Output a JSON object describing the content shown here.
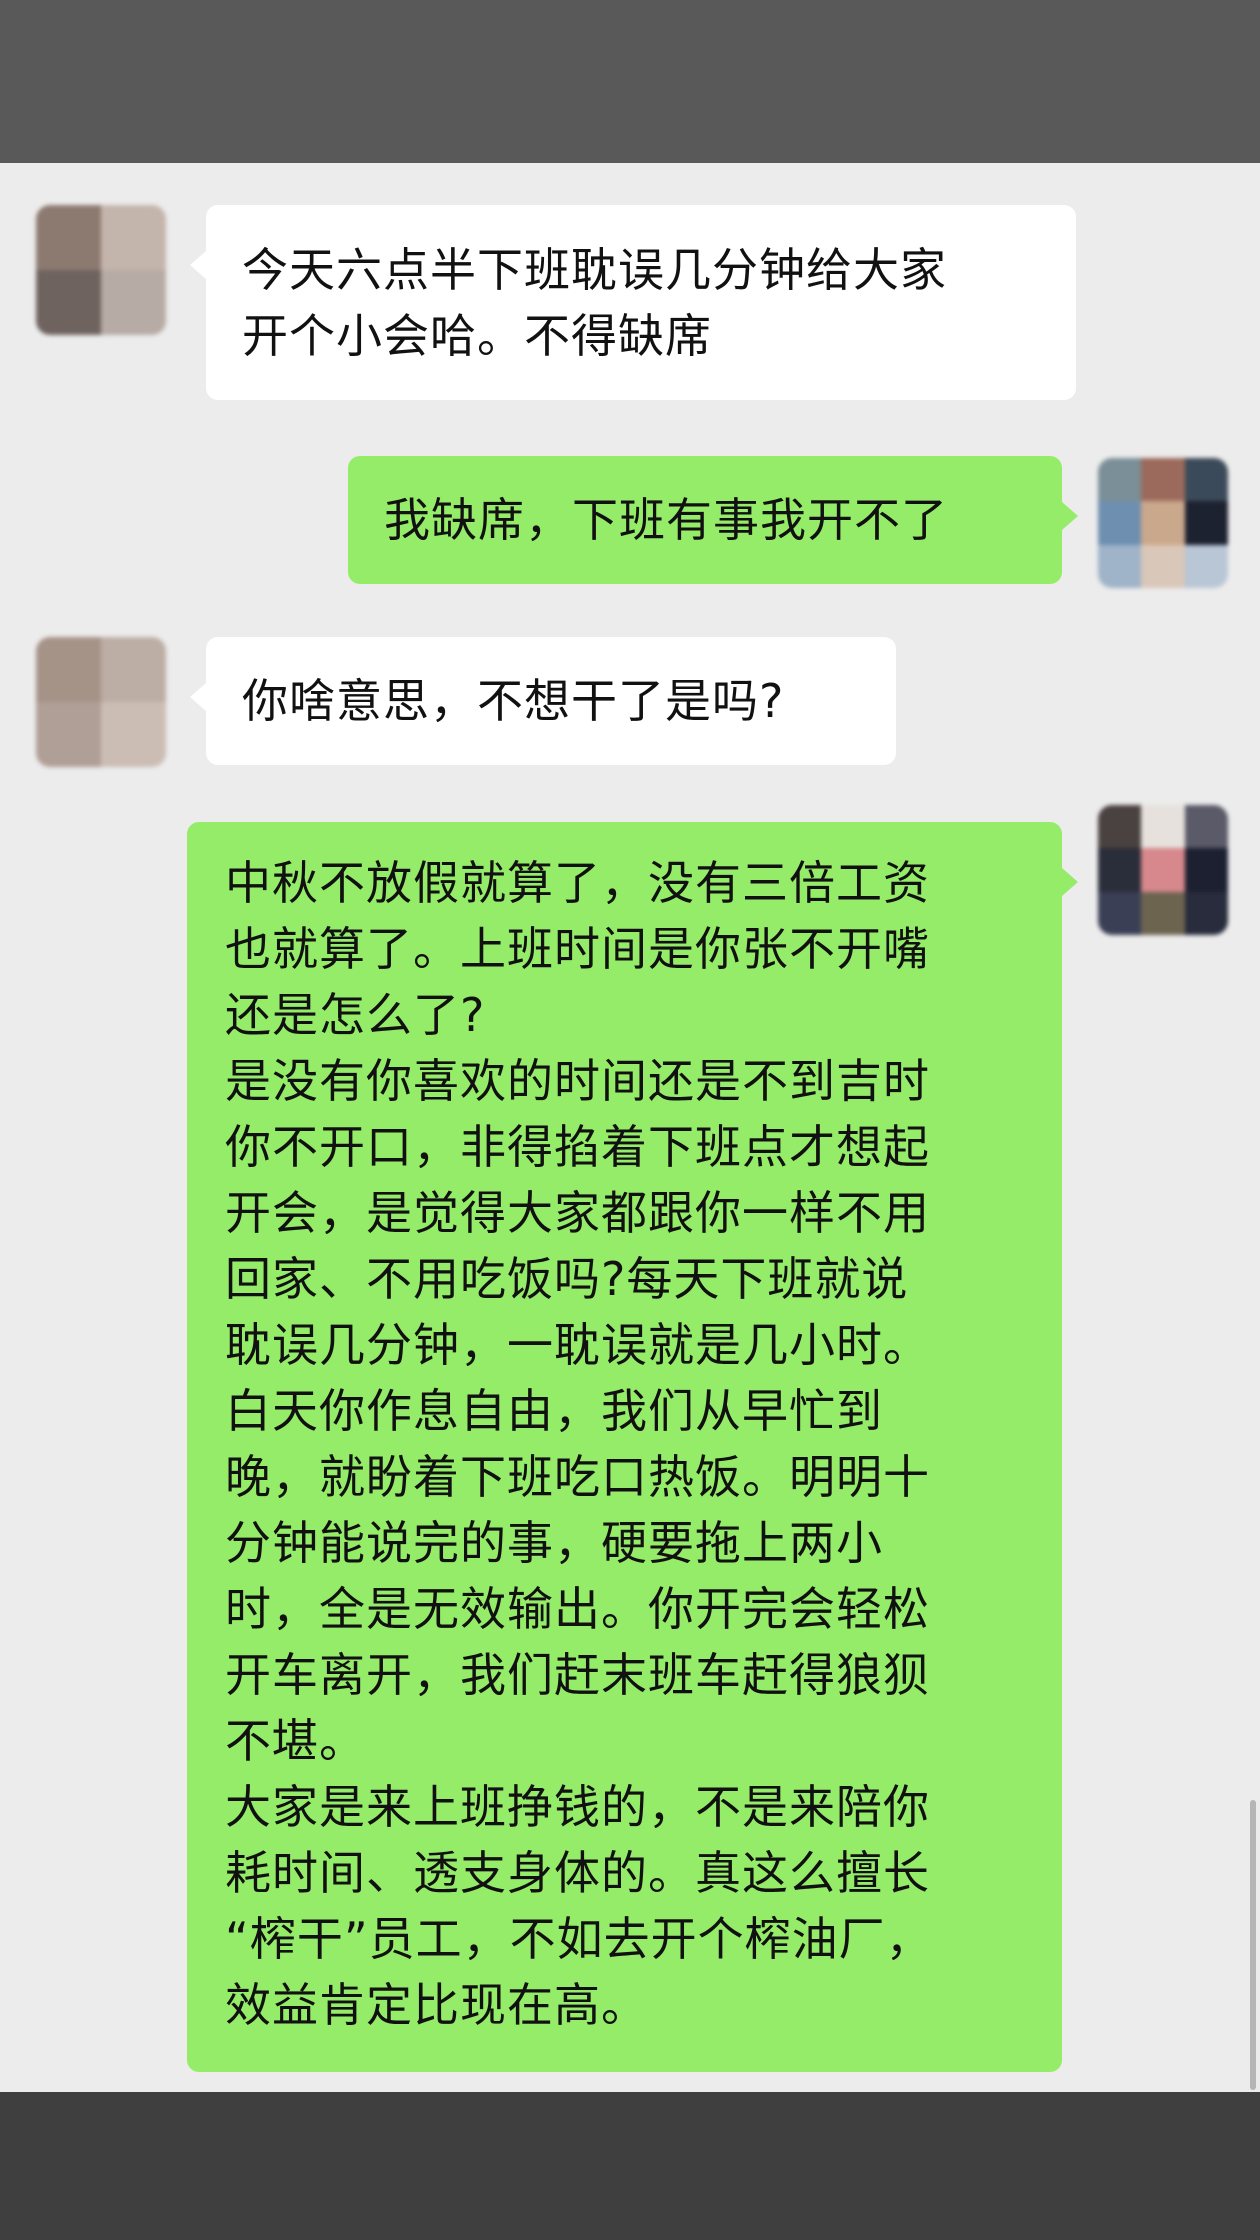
{
  "colors": {
    "top_bar": "#595959",
    "chat_background": "#ececec",
    "bottom_bar": "#3f3f3f",
    "incoming_bubble": "#ffffff",
    "outgoing_bubble": "#95ec69"
  },
  "messages": [
    {
      "sender": "other",
      "text": "今天六点半下班耽误几分钟给大家\n开个小会哈。不得缺席"
    },
    {
      "sender": "me",
      "text": "我缺席，下班有事我开不了"
    },
    {
      "sender": "other",
      "text": "你啥意思，不想干了是吗?"
    },
    {
      "sender": "me",
      "text": "中秋不放假就算了，没有三倍工资\n也就算了。上班时间是你张不开嘴\n还是怎么了?\n是没有你喜欢的时间还是不到吉时\n你不开口，非得掐着下班点才想起\n开会，是觉得大家都跟你一样不用\n回家、不用吃饭吗?每天下班就说\n耽误几分钟，一耽误就是几小时。\n白天你作息自由，我们从早忙到\n晚，就盼着下班吃口热饭。明明十\n分钟能说完的事，硬要拖上两小\n时，全是无效输出。你开完会轻松\n开车离开，我们赶末班车赶得狼狈\n不堪。\n大家是来上班挣钱的，不是来陪你\n耗时间、透支身体的。真这么擅长\n“榨干”员工，不如去开个榨油厂，\n效益肯定比现在高。"
    }
  ]
}
